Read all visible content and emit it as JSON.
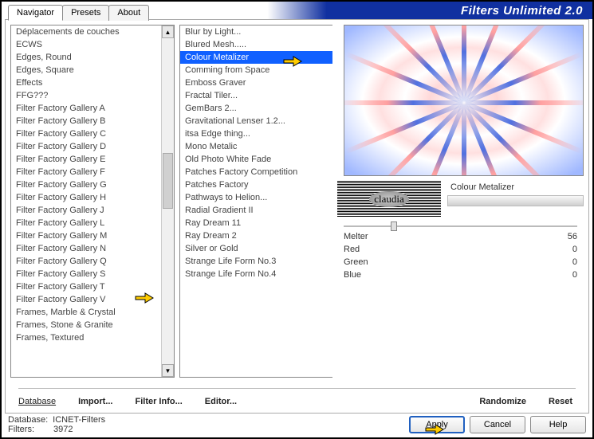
{
  "header": {
    "title": "Filters Unlimited 2.0"
  },
  "tabs": [
    "Navigator",
    "Presets",
    "About"
  ],
  "activeTab": 0,
  "categoryList": [
    "Déplacements de couches",
    "ECWS",
    "Edges, Round",
    "Edges, Square",
    "Effects",
    "FFG???",
    "Filter Factory Gallery A",
    "Filter Factory Gallery B",
    "Filter Factory Gallery C",
    "Filter Factory Gallery D",
    "Filter Factory Gallery E",
    "Filter Factory Gallery F",
    "Filter Factory Gallery G",
    "Filter Factory Gallery H",
    "Filter Factory Gallery J",
    "Filter Factory Gallery L",
    "Filter Factory Gallery M",
    "Filter Factory Gallery N",
    "Filter Factory Gallery Q",
    "Filter Factory Gallery S",
    "Filter Factory Gallery T",
    "Filter Factory Gallery V",
    "Frames, Marble & Crystal",
    "Frames, Stone & Granite",
    "Frames, Textured"
  ],
  "selectedCategoryIndex": 19,
  "filterList": [
    "Blur by Light...",
    "Blured Mesh.....",
    "Colour Metalizer",
    "Comming from Space",
    "Emboss Graver",
    "Fractal Tiler...",
    "GemBars 2...",
    "Gravitational Lenser 1.2...",
    "itsa Edge thing...",
    "Mono Metalic",
    "Old Photo White Fade",
    "Patches Factory Competition",
    "Patches Factory",
    "Pathways to Helion...",
    "Radial Gradient II",
    "Ray Dream 11",
    "Ray Dream 2",
    "Silver or Gold",
    "Strange Life Form No.3",
    "Strange Life Form No.4"
  ],
  "selectedFilterIndex": 2,
  "logoText": "claudia",
  "filterTitle": "Colour Metalizer",
  "params": [
    {
      "name": "Melter",
      "value": 56
    },
    {
      "name": "Red",
      "value": 0
    },
    {
      "name": "Green",
      "value": 0
    },
    {
      "name": "Blue",
      "value": 0
    }
  ],
  "bottomLinks": {
    "database": "Database",
    "import": "Import...",
    "filterInfo": "Filter Info...",
    "editor": "Editor...",
    "randomize": "Randomize",
    "reset": "Reset"
  },
  "status": {
    "dbLabel": "Database:",
    "dbValue": "ICNET-Filters",
    "filtersLabel": "Filters:",
    "filtersValue": "3972"
  },
  "buttons": {
    "apply": "Apply",
    "cancel": "Cancel",
    "help": "Help"
  }
}
